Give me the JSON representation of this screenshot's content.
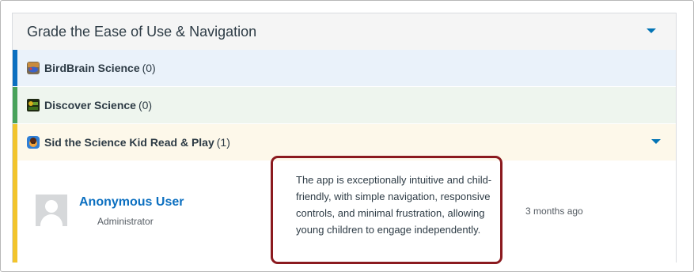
{
  "panel": {
    "title": "Grade the Ease of Use & Navigation"
  },
  "apps": [
    {
      "name": "BirdBrain Science",
      "count": "(0)",
      "icon": "birdbrain-app-icon",
      "accent": "#0b6fc0"
    },
    {
      "name": "Discover Science",
      "count": "(0)",
      "icon": "discover-app-icon",
      "accent": "#48a25a"
    },
    {
      "name": "Sid the Science Kid Read & Play",
      "count": "(1)",
      "icon": "sid-app-icon",
      "accent": "#f2c42c"
    }
  ],
  "review": {
    "user_name": "Anonymous User",
    "role": "Administrator",
    "comment": "The app is exceptionally intuitive and child-friendly, with simple navigation, responsive controls, and minimal frustration, allowing young children to engage independently.",
    "time": "3 months ago"
  },
  "colors": {
    "link": "#0b6fc0",
    "highlight_border": "#8b1a1f"
  }
}
